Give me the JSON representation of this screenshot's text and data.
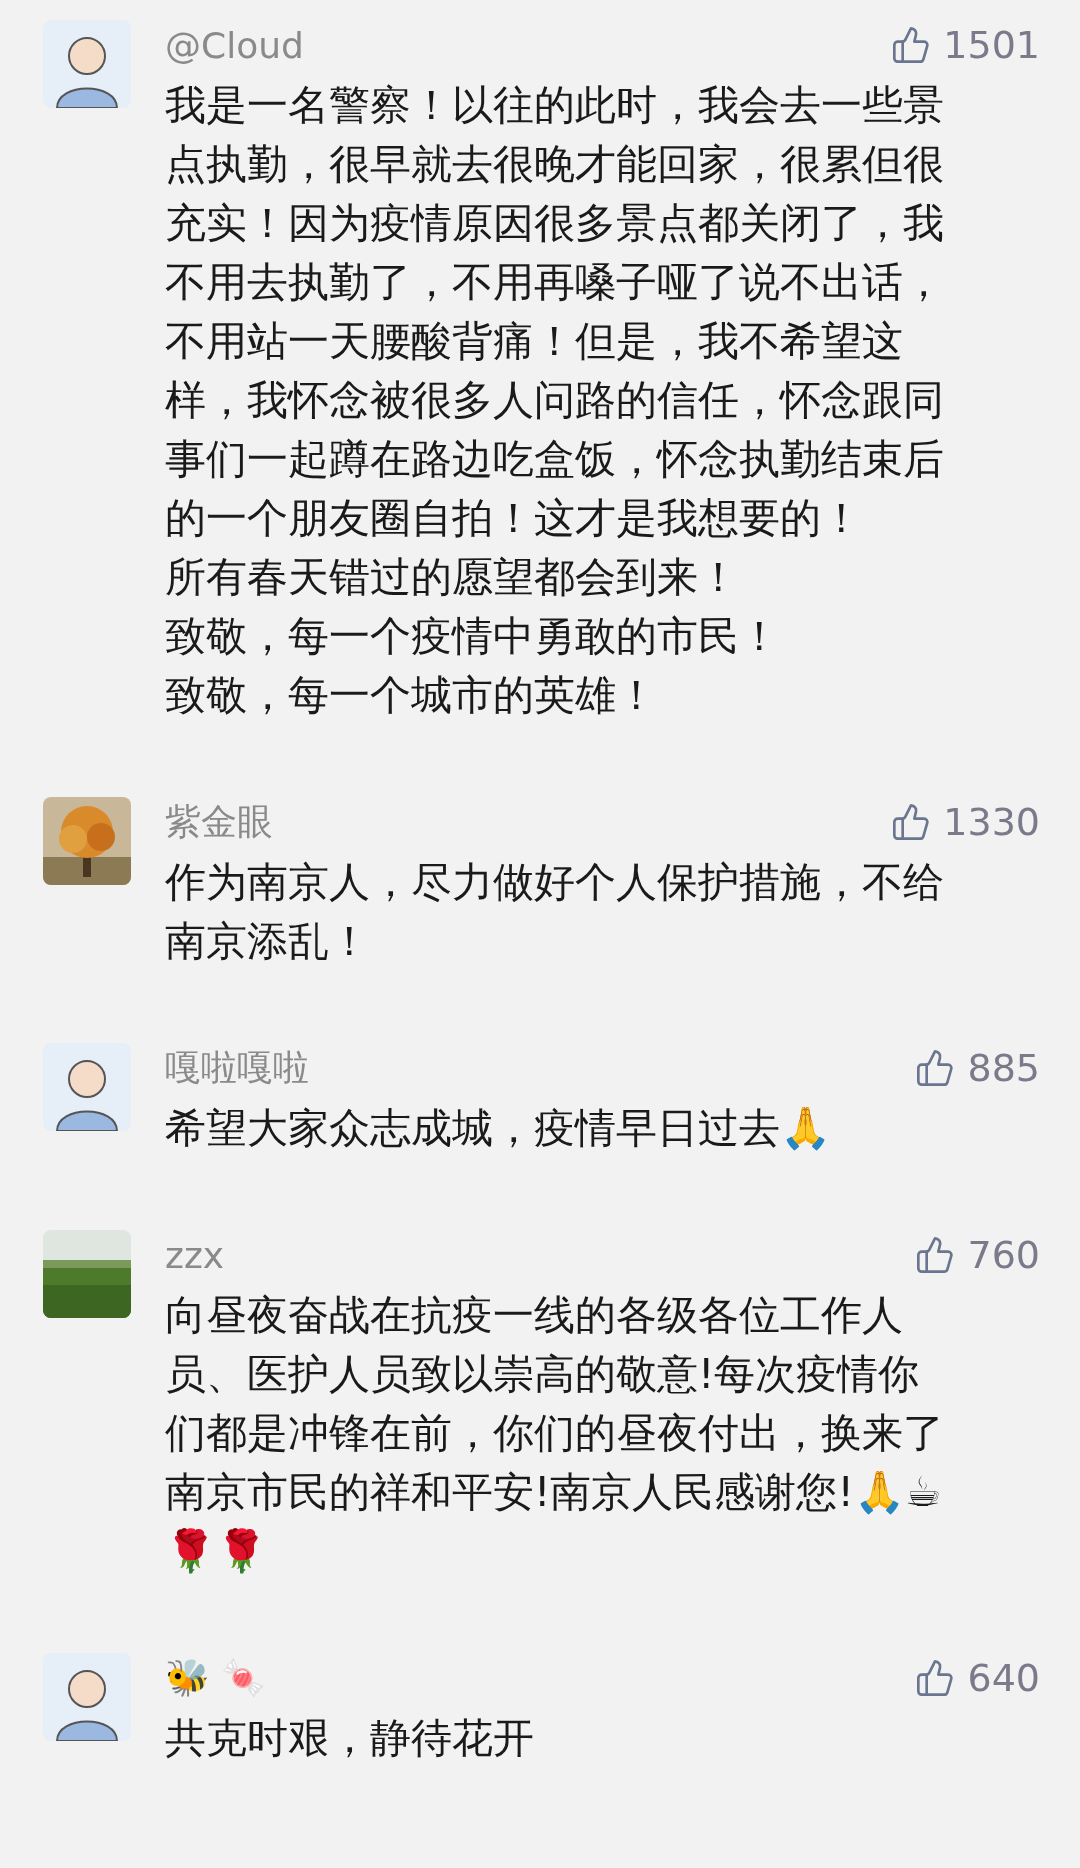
{
  "comments": [
    {
      "name": "@Cloud",
      "likes": "1501",
      "paragraphs": [
        "我是一名警察！以往的此时，我会去一些景点执勤，很早就去很晚才能回家，很累但很充实！因为疫情原因很多景点都关闭了，我不用去执勤了，不用再嗓子哑了说不出话，不用站一天腰酸背痛！但是，我不希望这样，我怀念被很多人问路的信任，怀念跟同事们一起蹲在路边吃盒饭，怀念执勤结束后的一个朋友圈自拍！这才是我想要的！",
        "所有春天错过的愿望都会到来！",
        "致敬，每一个疫情中勇敢的市民！",
        "致敬，每一个城市的英雄！"
      ]
    },
    {
      "name": "紫金眼",
      "likes": "1330",
      "paragraphs": [
        "作为南京人，尽力做好个人保护措施，不给南京添乱！"
      ]
    },
    {
      "name": "嘎啦嘎啦",
      "likes": "885",
      "paragraphs": [
        "希望大家众志成城，疫情早日过去🙏"
      ]
    },
    {
      "name": "zzx",
      "likes": "760",
      "paragraphs": [
        "向昼夜奋战在抗疫一线的各级各位工作人员、医护人员致以崇高的敬意!每次疫情你们都是冲锋在前，你们的昼夜付出，换来了南京市民的祥和平安!南京人民感谢您!🙏☕🌹🌹"
      ]
    },
    {
      "name": "🐝 🍬",
      "likes": "640",
      "paragraphs": [
        "共克时艰，静待花开"
      ]
    }
  ]
}
